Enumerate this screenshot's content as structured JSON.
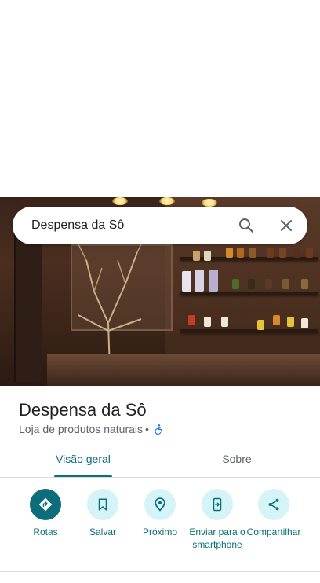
{
  "search": {
    "query": "Despensa da Sô"
  },
  "place": {
    "name": "Despensa da Sô",
    "category": "Loja de produtos naturais",
    "separator": "•"
  },
  "tabs": [
    {
      "label": "Visão geral",
      "selected": true
    },
    {
      "label": "Sobre",
      "selected": false
    }
  ],
  "actions": [
    {
      "label": "Rotas",
      "icon": "directions-icon"
    },
    {
      "label": "Salvar",
      "icon": "bookmark-icon"
    },
    {
      "label": "Próximo",
      "icon": "nearby-icon"
    },
    {
      "label": "Enviar para o smartphone",
      "icon": "send-to-phone-icon"
    },
    {
      "label": "Compartilhar",
      "icon": "share-icon"
    }
  ],
  "colors": {
    "accent": "#0b6e7a",
    "action_bg": "#d4f4f8",
    "text_primary": "#202124",
    "text_secondary": "#5f6368"
  }
}
